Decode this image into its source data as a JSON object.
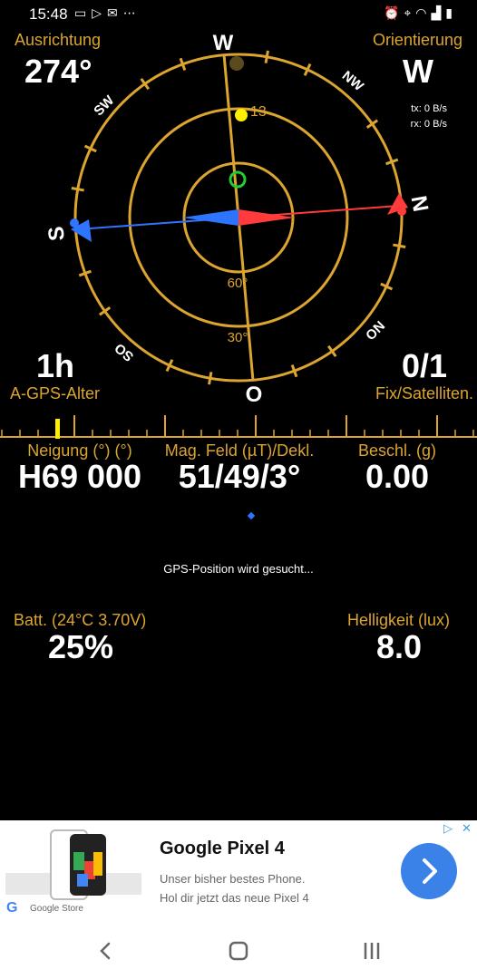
{
  "status": {
    "time": "15:48",
    "left_icons": [
      "laptop-icon",
      "play-store-icon",
      "gmail-icon",
      "more-dots-icon"
    ],
    "right_icons": [
      "alarm-icon",
      "location-icon",
      "wifi-icon",
      "signal-icon",
      "battery-icon"
    ]
  },
  "heading": {
    "label": "Ausrichtung",
    "value": "274°"
  },
  "orientation": {
    "label": "Orientierung",
    "value": "W",
    "tx": "tx: 0 B/s",
    "rx": "rx: 0 B/s"
  },
  "compass": {
    "cardinals": {
      "n": "N",
      "e": "O",
      "s": "S",
      "w": "W"
    },
    "intercardinals": {
      "nw": "NW",
      "sw": "SW",
      "so": "SO",
      "no": "NO"
    },
    "ring_labels": {
      "inner": "60°",
      "middle": "30°"
    },
    "satellite_number": "13",
    "colors": {
      "ring": "#dba52f",
      "needle_red": "#ff3b3b",
      "needle_blue": "#2f74ff",
      "gps_ring": "#22cc33",
      "satellite": "#ffee00"
    }
  },
  "agps": {
    "value": "1h",
    "label": "A-GPS-Alter"
  },
  "fix": {
    "value": "0/1",
    "label": "Fix/Satelliten."
  },
  "metrics": [
    {
      "label": "Neigung (°) (°)",
      "value": "H69 000"
    },
    {
      "label": "Mag. Feld (µT)/Dekl.",
      "value": "51/49/3°"
    },
    {
      "label": "Beschl. (g)",
      "value": "0.00"
    }
  ],
  "gps_status": "GPS-Position wird gesucht...",
  "battery": {
    "label": "Batt. (24°C 3.70V)",
    "value": "25%"
  },
  "brightness": {
    "label": "Helligkeit (lux)",
    "value": "8.0"
  },
  "ad": {
    "title": "Google Pixel 4",
    "line1": "Unser bisher bestes Phone.",
    "line2": "Hol dir jetzt das neue Pixel 4",
    "store": "Google Store",
    "adchoices": "▷",
    "close": "✕"
  }
}
